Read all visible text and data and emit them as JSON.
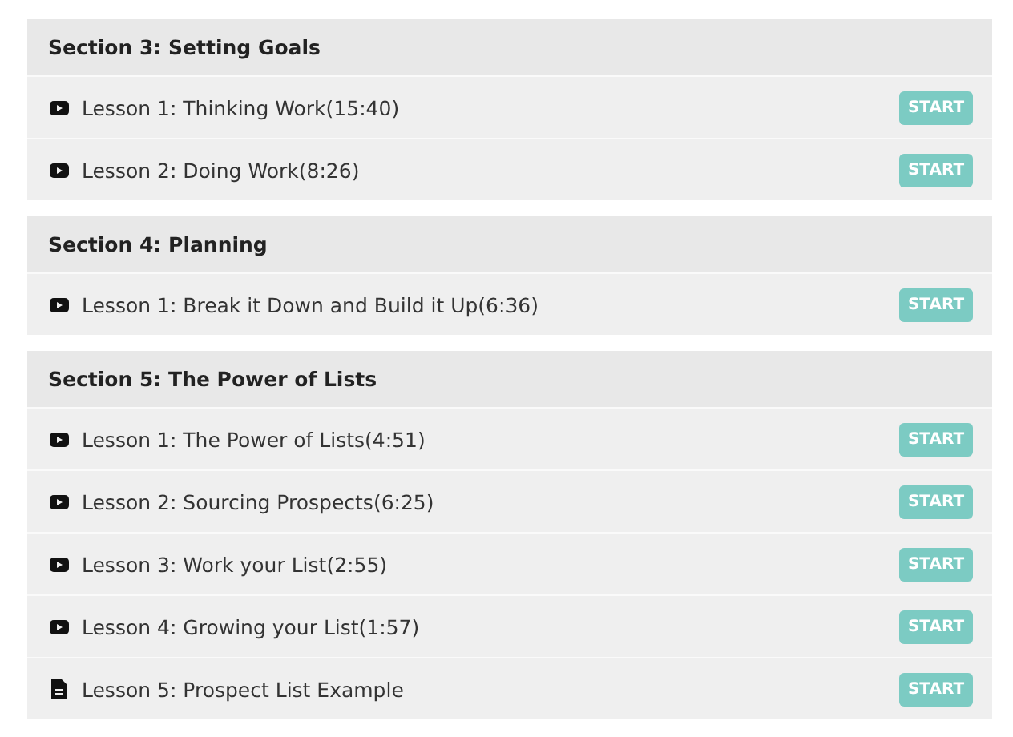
{
  "sections": [
    {
      "title": "Section 3: Setting Goals",
      "lessons": [
        {
          "kind": "video",
          "title": "Lesson 1: Thinking Work(15:40)",
          "button": "START"
        },
        {
          "kind": "video",
          "title": "Lesson 2: Doing Work(8:26)",
          "button": "START"
        }
      ]
    },
    {
      "title": "Section 4: Planning",
      "lessons": [
        {
          "kind": "video",
          "title": "Lesson 1: Break it Down and Build it Up(6:36)",
          "button": "START"
        }
      ]
    },
    {
      "title": "Section 5: The Power of Lists",
      "lessons": [
        {
          "kind": "video",
          "title": "Lesson 1: The Power of Lists(4:51)",
          "button": "START"
        },
        {
          "kind": "video",
          "title": "Lesson 2: Sourcing Prospects(6:25)",
          "button": "START"
        },
        {
          "kind": "video",
          "title": "Lesson 3: Work your List(2:55)",
          "button": "START"
        },
        {
          "kind": "video",
          "title": "Lesson 4: Growing your List(1:57)",
          "button": "START"
        },
        {
          "kind": "document",
          "title": "Lesson 5: Prospect List Example",
          "button": "START"
        }
      ]
    }
  ]
}
